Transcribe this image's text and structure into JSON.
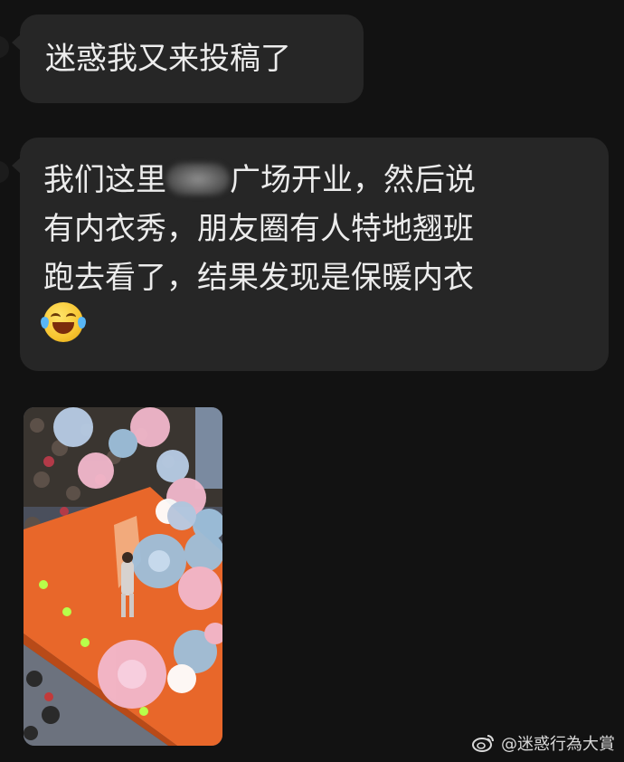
{
  "messages": [
    {
      "lines": [
        "迷惑我又来投稿了"
      ]
    },
    {
      "line1_before": "我们这里",
      "line1_after": "广场开业，然后说",
      "line2": "有内衣秀，朋友圈有人特地翘班",
      "line3": "跑去看了，结果发现是保暖内衣",
      "emoji": "laughing-tears-emoji"
    }
  ],
  "image_message": {
    "icon": "photo-thumbnail"
  },
  "watermark": {
    "text": "@迷惑行為大賞",
    "icon": "weibo-logo-icon"
  },
  "colors": {
    "background": "#121212",
    "bubble": "#262626",
    "text": "#ececec",
    "stage": "#e8672a"
  }
}
